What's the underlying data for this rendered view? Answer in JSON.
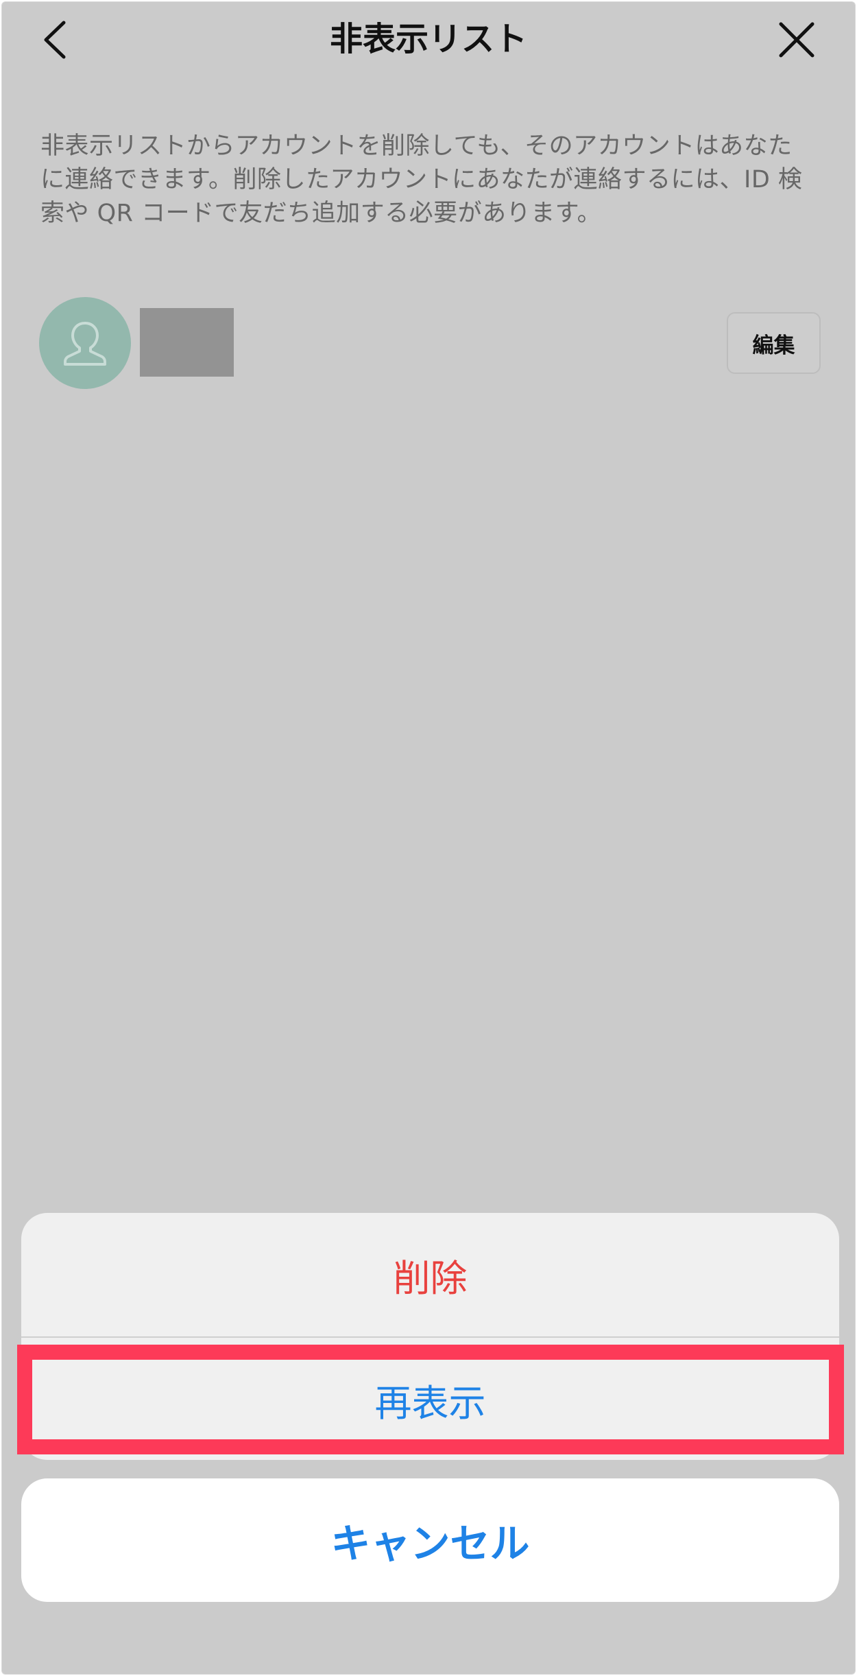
{
  "header": {
    "title": "非表示リスト",
    "back_icon": "chevron-left-icon",
    "close_icon": "close-icon"
  },
  "description": "非表示リストからアカウントを削除しても、そのアカウントはあなたに連絡できます。削除したアカウントにあなたが連絡するには、ID 検索や QR コードで友だち追加する必要があります。",
  "hidden_list": {
    "items": [
      {
        "avatar_icon": "person-icon",
        "edit_label": "編集"
      }
    ]
  },
  "action_sheet": {
    "delete_label": "削除",
    "unhide_label": "再表示",
    "cancel_label": "キャンセル"
  },
  "colors": {
    "delete": "#e8413e",
    "accent": "#1e82e6",
    "highlight": "#fd3a58",
    "overlay_background": "#cbcbcb",
    "avatar": "#93b8ad"
  }
}
